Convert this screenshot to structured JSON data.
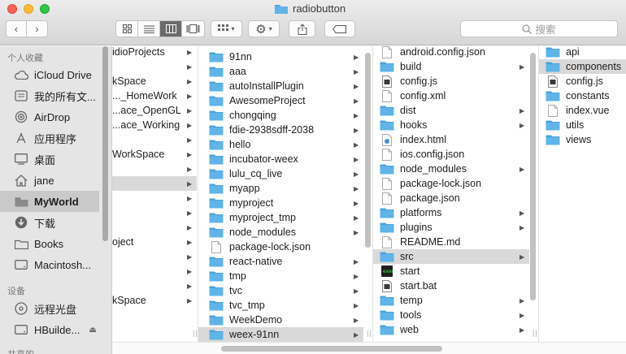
{
  "window": {
    "title": "radiobutton"
  },
  "toolbar": {
    "back_icon": "chevron-left-icon",
    "forward_icon": "chevron-right-icon",
    "view_modes": [
      "icon-view",
      "list-view",
      "column-view",
      "gallery-view"
    ],
    "active_view": "column-view",
    "search_placeholder": "搜索"
  },
  "sidebar": {
    "favorites_heading": "个人收藏",
    "favorites": [
      {
        "label": "iCloud Drive",
        "icon": "cloud-icon"
      },
      {
        "label": "我的所有文...",
        "icon": "all-files-icon"
      },
      {
        "label": "AirDrop",
        "icon": "airdrop-icon"
      },
      {
        "label": "应用程序",
        "icon": "applications-icon"
      },
      {
        "label": "桌面",
        "icon": "desktop-icon"
      },
      {
        "label": "jane",
        "icon": "home-icon"
      },
      {
        "label": "MyWorld",
        "icon": "folder-icon",
        "selected": true
      },
      {
        "label": "下载",
        "icon": "download-icon"
      },
      {
        "label": "Books",
        "icon": "folder-icon"
      },
      {
        "label": "Macintosh...",
        "icon": "disk-icon"
      }
    ],
    "devices_heading": "设备",
    "devices": [
      {
        "label": "远程光盘",
        "icon": "optical-disc-icon"
      },
      {
        "label": "HBuilde...",
        "icon": "disk-icon",
        "eject": true
      }
    ],
    "shared_heading": "共享的"
  },
  "columns": {
    "col1": [
      {
        "name": "idioProjects",
        "arrow": true
      },
      {
        "name": "",
        "arrow": true
      },
      {
        "name": "kSpace",
        "arrow": true
      },
      {
        "name": "..._HomeWork",
        "arrow": true
      },
      {
        "name": "...ace_OpenGL",
        "arrow": true
      },
      {
        "name": "...ace_Working",
        "arrow": true
      },
      {
        "name": "",
        "arrow": true
      },
      {
        "name": "WorkSpace",
        "arrow": true
      },
      {
        "name": "",
        "arrow": true
      },
      {
        "name": "",
        "arrow": true,
        "selected": true
      },
      {
        "name": "",
        "arrow": true
      },
      {
        "name": "",
        "arrow": true
      },
      {
        "name": "",
        "arrow": true
      },
      {
        "name": "oject",
        "arrow": true
      },
      {
        "name": "",
        "arrow": true
      },
      {
        "name": "",
        "arrow": true
      },
      {
        "name": "",
        "arrow": true
      },
      {
        "name": "kSpace",
        "arrow": true
      }
    ],
    "col2": [
      {
        "name": "91nn",
        "type": "folder",
        "arrow": true
      },
      {
        "name": "aaa",
        "type": "folder",
        "arrow": true
      },
      {
        "name": "autoInstallPlugin",
        "type": "folder",
        "arrow": true
      },
      {
        "name": "AwesomeProject",
        "type": "folder",
        "arrow": true
      },
      {
        "name": "chongqing",
        "type": "folder",
        "arrow": true
      },
      {
        "name": "fdie-2938sdff-2038",
        "type": "folder",
        "arrow": true
      },
      {
        "name": "hello",
        "type": "folder",
        "arrow": true
      },
      {
        "name": "incubator-weex",
        "type": "folder",
        "arrow": true
      },
      {
        "name": "lulu_cq_live",
        "type": "folder",
        "arrow": true
      },
      {
        "name": "myapp",
        "type": "folder",
        "arrow": true
      },
      {
        "name": "myproject",
        "type": "folder",
        "arrow": true
      },
      {
        "name": "myproject_tmp",
        "type": "folder",
        "arrow": true
      },
      {
        "name": "node_modules",
        "type": "folder",
        "arrow": true
      },
      {
        "name": "package-lock.json",
        "type": "file",
        "arrow": false
      },
      {
        "name": "react-native",
        "type": "folder",
        "arrow": true
      },
      {
        "name": "tmp",
        "type": "folder",
        "arrow": true
      },
      {
        "name": "tvc",
        "type": "folder",
        "arrow": true
      },
      {
        "name": "tvc_tmp",
        "type": "folder",
        "arrow": true
      },
      {
        "name": "WeekDemo",
        "type": "folder",
        "arrow": true
      },
      {
        "name": "weex-91nn",
        "type": "folder",
        "arrow": true,
        "selected": true
      }
    ],
    "col3": [
      {
        "name": "android.config.json",
        "type": "file",
        "arrow": false
      },
      {
        "name": "build",
        "type": "folder",
        "arrow": true
      },
      {
        "name": "config.js",
        "type": "script",
        "arrow": false
      },
      {
        "name": "config.xml",
        "type": "file",
        "arrow": false
      },
      {
        "name": "dist",
        "type": "folder",
        "arrow": true
      },
      {
        "name": "hooks",
        "type": "folder",
        "arrow": true
      },
      {
        "name": "index.html",
        "type": "html",
        "arrow": false
      },
      {
        "name": "ios.config.json",
        "type": "file",
        "arrow": false
      },
      {
        "name": "node_modules",
        "type": "folder",
        "arrow": true
      },
      {
        "name": "package-lock.json",
        "type": "file",
        "arrow": false
      },
      {
        "name": "package.json",
        "type": "file",
        "arrow": false
      },
      {
        "name": "platforms",
        "type": "folder",
        "arrow": true
      },
      {
        "name": "plugins",
        "type": "folder",
        "arrow": true
      },
      {
        "name": "README.md",
        "type": "file",
        "arrow": false
      },
      {
        "name": "src",
        "type": "folder",
        "arrow": true,
        "selected": true
      },
      {
        "name": "start",
        "type": "exec",
        "arrow": false
      },
      {
        "name": "start.bat",
        "type": "script",
        "arrow": false
      },
      {
        "name": "temp",
        "type": "folder",
        "arrow": true
      },
      {
        "name": "tools",
        "type": "folder",
        "arrow": true
      },
      {
        "name": "web",
        "type": "folder",
        "arrow": true
      }
    ],
    "col4": [
      {
        "name": "api",
        "type": "folder"
      },
      {
        "name": "components",
        "type": "folder",
        "selected": true
      },
      {
        "name": "config.js",
        "type": "script"
      },
      {
        "name": "constants",
        "type": "folder"
      },
      {
        "name": "index.vue",
        "type": "file"
      },
      {
        "name": "utils",
        "type": "folder"
      },
      {
        "name": "views",
        "type": "folder"
      }
    ]
  },
  "colors": {
    "folder": "#5fb4ea",
    "folder_tab": "#4aa3dc",
    "selection": "#d9d9d9",
    "sidebar_bg": "#e5e5e5"
  }
}
